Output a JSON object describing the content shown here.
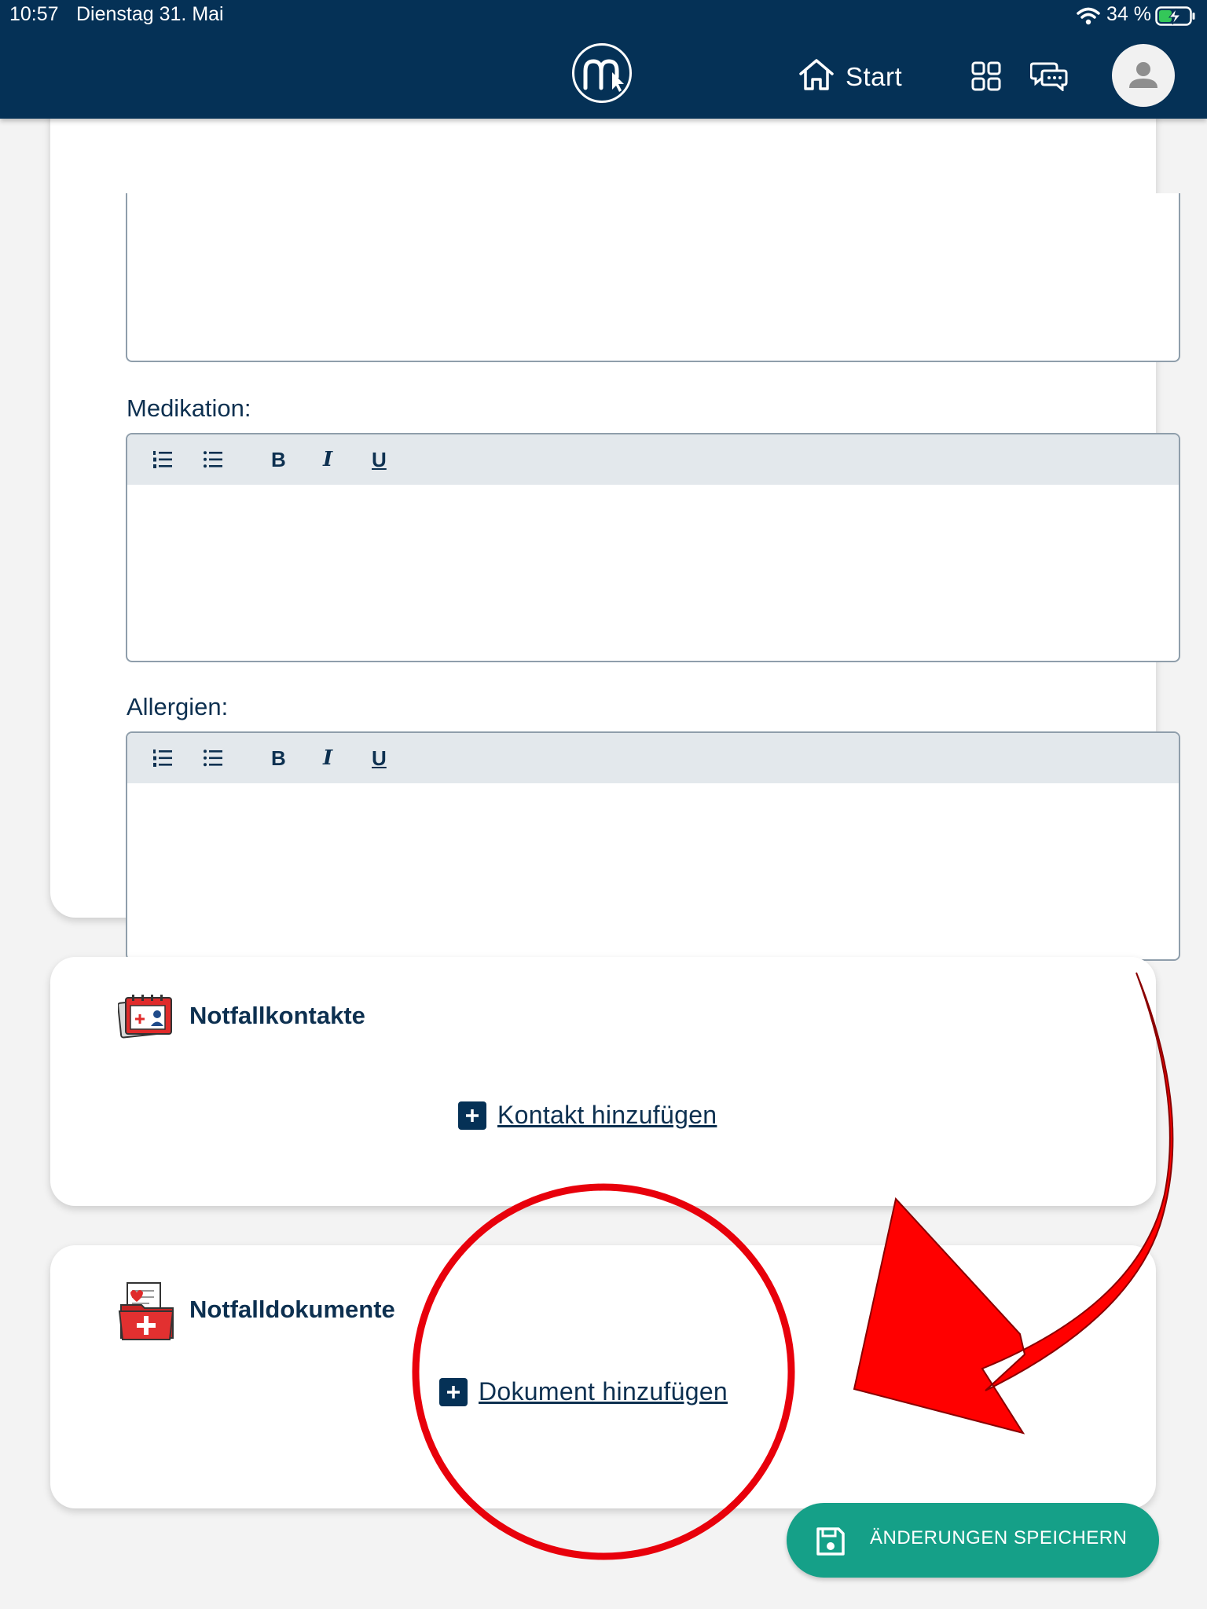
{
  "status_bar": {
    "time": "10:57",
    "date": "Dienstag 31. Mai",
    "battery": "34 %"
  },
  "header": {
    "logo_icon": "app-logo-icon",
    "home_label": "Start",
    "icons": [
      "home-icon",
      "grid-icon",
      "chat-icon",
      "avatar-icon"
    ]
  },
  "form": {
    "medication_label": "Medikation:",
    "allergies_label": "Allergien:",
    "medication_value": "",
    "allergies_value": "",
    "toolbar": {
      "ordered_list_icon": "ordered-list-icon",
      "bullet_list_icon": "bullet-list-icon",
      "bold": "B",
      "italic": "I",
      "underline": "U"
    }
  },
  "contacts": {
    "title": "Notfallkontakte",
    "add_label": "Kontakt hinzufügen"
  },
  "documents": {
    "title": "Notfalldokumente",
    "add_label": "Dokument hinzufügen"
  },
  "save_button": {
    "label": "ÄNDERUNGEN SPEICHERN"
  },
  "colors": {
    "header_bg": "#053156",
    "primary_text": "#0d3050",
    "save_button": "#15a088",
    "annotation": "#ff0000"
  }
}
